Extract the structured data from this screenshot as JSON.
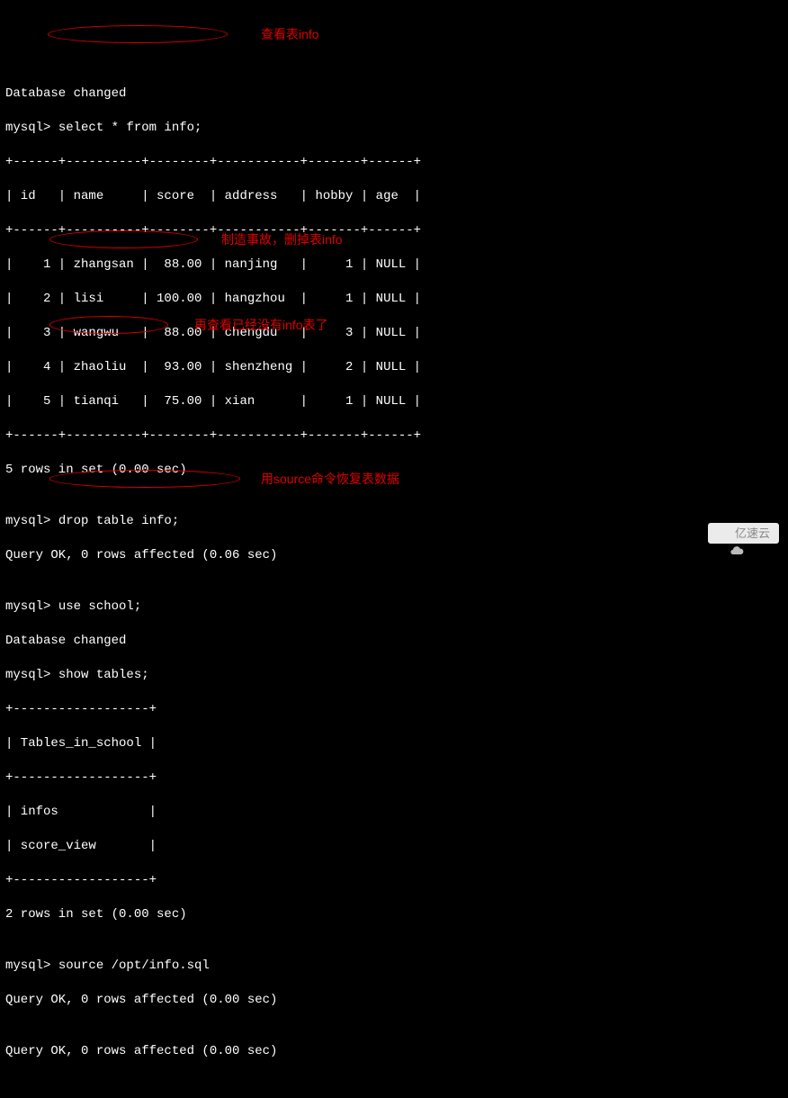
{
  "lines": {
    "db_changed_1": "Database changed",
    "prompt": "mysql> ",
    "cmd_select": "select * from info;",
    "annot_select": "查看表info",
    "table_sep_top": "+------+----------+--------+-----------+-------+------+",
    "table_header": "| id   | name     | score  | address   | hobby | age  |",
    "table_sep_mid": "+------+----------+--------+-----------+-------+------+",
    "row1": "|    1 | zhangsan |  88.00 | nanjing   |     1 | NULL |",
    "row2": "|    2 | lisi     | 100.00 | hangzhou  |     1 | NULL |",
    "row3": "|    3 | wangwu   |  88.00 | chengdu   |     3 | NULL |",
    "row4": "|    4 | zhaoliu  |  93.00 | shenzheng |     2 | NULL |",
    "row5": "|    5 | tianqi   |  75.00 | xian      |     1 | NULL |",
    "table_sep_bot": "+------+----------+--------+-----------+-------+------+",
    "rows_in_set_5": "5 rows in set (0.00 sec)",
    "blank": "",
    "cmd_drop": "drop table info;",
    "annot_drop": "制造事故，删掉表info",
    "query_ok_006": "Query OK, 0 rows affected (0.06 sec)",
    "cmd_use": "use school;",
    "db_changed_2": "Database changed",
    "cmd_show": "show tables;",
    "annot_show": "再查看已经没有info表了",
    "tbl2_sep": "+------------------+",
    "tbl2_header": "| Tables_in_school |",
    "tbl2_row1": "| infos            |",
    "tbl2_row2": "| score_view       |",
    "rows_in_set_2": "2 rows in set (0.00 sec)",
    "cmd_source": "source /opt/info.sql",
    "annot_source": "用source命令恢复表数据",
    "query_ok_000_1": "Query OK, 0 rows affected (0.00 sec)",
    "query_ok_000_2": "Query OK, 0 rows affected (0.00 sec)"
  },
  "table_data": {
    "columns": [
      "id",
      "name",
      "score",
      "address",
      "hobby",
      "age"
    ],
    "rows": [
      {
        "id": 1,
        "name": "zhangsan",
        "score": 88.0,
        "address": "nanjing",
        "hobby": 1,
        "age": null
      },
      {
        "id": 2,
        "name": "lisi",
        "score": 100.0,
        "address": "hangzhou",
        "hobby": 1,
        "age": null
      },
      {
        "id": 3,
        "name": "wangwu",
        "score": 88.0,
        "address": "chengdu",
        "hobby": 3,
        "age": null
      },
      {
        "id": 4,
        "name": "zhaoliu",
        "score": 93.0,
        "address": "shenzheng",
        "hobby": 2,
        "age": null
      },
      {
        "id": 5,
        "name": "tianqi",
        "score": 75.0,
        "address": "xian",
        "hobby": 1,
        "age": null
      }
    ]
  },
  "tables_in_school": [
    "infos",
    "score_view"
  ],
  "watermark": "亿速云"
}
